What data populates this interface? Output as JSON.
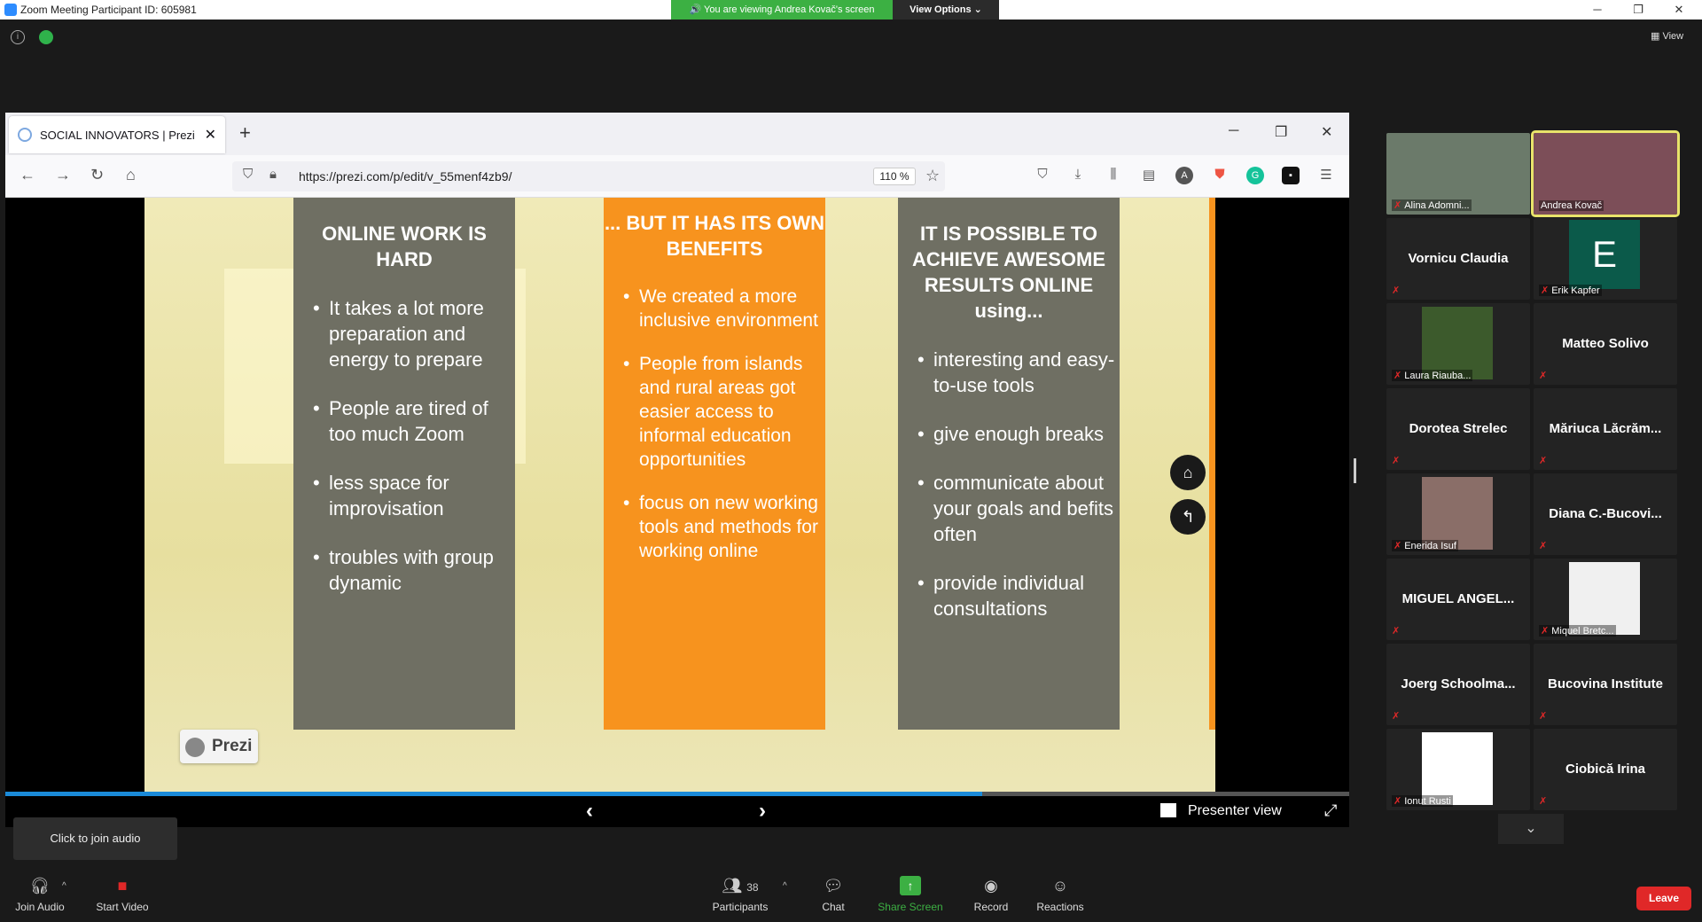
{
  "window": {
    "title": "Zoom Meeting Participant ID: 605981",
    "viewing_banner": "You are viewing Andrea Kovač's screen",
    "view_options": "View Options",
    "view_button": "View"
  },
  "browser": {
    "tab_title": "SOCIAL INNOVATORS | Prezi",
    "url": "https://prezi.com/p/edit/v_55menf4zb9/",
    "zoom": "110 %"
  },
  "slide": {
    "col1": {
      "heading": "ONLINE WORK IS HARD",
      "bullets": [
        "It takes a lot more preparation and energy to prepare",
        "People are tired of too much Zoom",
        "less space for improvisation",
        "troubles with group dynamic"
      ]
    },
    "col2": {
      "heading": "... BUT IT HAS ITS OWN BENEFITS",
      "bullets": [
        "We created a more inclusive environment",
        "People from islands and rural areas got easier access to informal education opportunities",
        "focus on new working tools and methods for working online"
      ]
    },
    "col3": {
      "heading": "IT IS POSSIBLE TO ACHIEVE AWESOME RESULTS ONLINE using...",
      "bullets": [
        "interesting and easy-to-use tools",
        "give enough breaks",
        "communicate about your goals and befits often",
        "provide individual consultations"
      ]
    },
    "badge": "Prezi",
    "presenter_view": "Presenter view",
    "progress": 0.727
  },
  "participants": [
    {
      "name": "Alina Adomni...",
      "video": true,
      "label": true
    },
    {
      "name": "Andrea Kovač",
      "video": true,
      "label": true,
      "active": true
    },
    {
      "name": "Vornicu Claudia",
      "video": false
    },
    {
      "name": "Erik Kapfer",
      "video": false,
      "initial": "E",
      "label": true
    },
    {
      "name": "Laura Riauba...",
      "video": true,
      "label": true
    },
    {
      "name": "Matteo Solivo",
      "video": false
    },
    {
      "name": "Dorotea Strelec",
      "video": false
    },
    {
      "name": "Măriuca  Lăcrăm...",
      "video": false
    },
    {
      "name": "Enerida Isuf",
      "video": true,
      "label": true
    },
    {
      "name": "Diana  C.-Bucovi...",
      "video": false
    },
    {
      "name": "MIGUEL ANGEL...",
      "video": false
    },
    {
      "name": "Miquel Bretc...",
      "video": true,
      "label": true
    },
    {
      "name": "Joerg  Schoolma...",
      "video": false
    },
    {
      "name": "Bucovina Institute",
      "video": false
    },
    {
      "name": "Ionut Rusti",
      "video": true,
      "label": true
    },
    {
      "name": "Ciobică Irina",
      "video": false
    }
  ],
  "toolbar": {
    "tip": "Click to join audio",
    "join_audio": "Join Audio",
    "start_video": "Start Video",
    "participants": "Participants",
    "participants_count": "38",
    "chat": "Chat",
    "share_screen": "Share Screen",
    "record": "Record",
    "reactions": "Reactions",
    "leave": "Leave"
  }
}
